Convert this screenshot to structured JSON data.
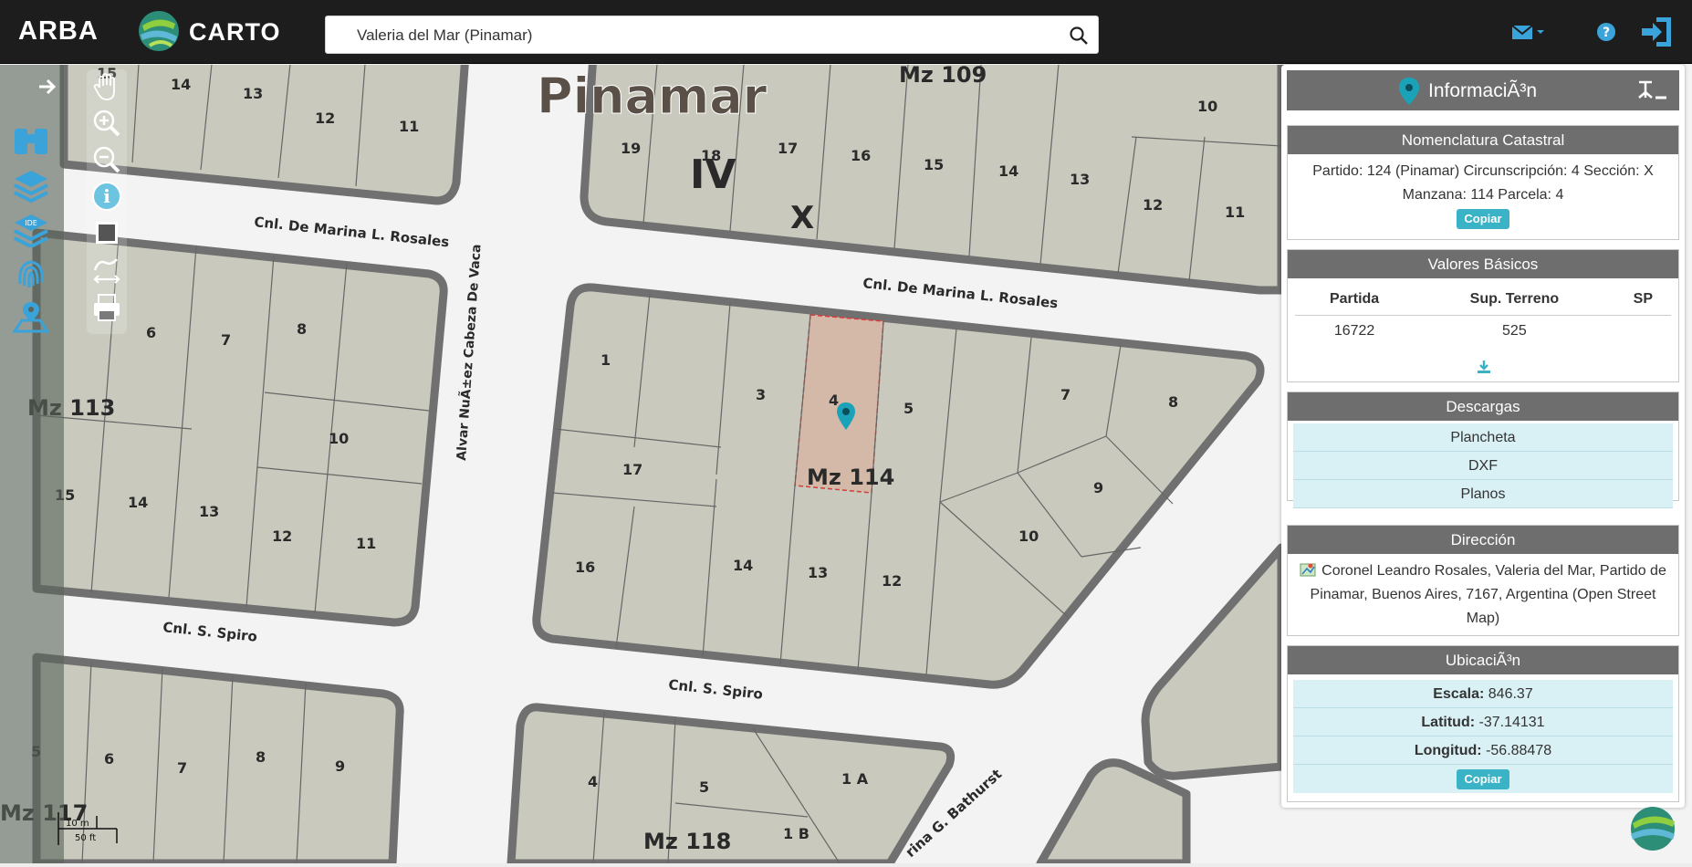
{
  "header": {
    "brand": "ARBA",
    "carto_label": "CARTO",
    "search": {
      "value": "Valeria del Mar (Pinamar)"
    },
    "icons": [
      "mail-icon",
      "chevron-down-icon",
      "help-icon",
      "logout-icon"
    ]
  },
  "map": {
    "city_label": "Pinamar",
    "circ_label": "IV",
    "sec_label": "X",
    "blocks": [
      "Mz 109",
      "Mz 113",
      "Mz 114",
      "Mz 117",
      "Mz 118"
    ],
    "streets": [
      "Cnl. De Marina L. Rosales",
      "Cnl. De Marina L. Rosales",
      "Alvar NuÃ±ez Cabeza De Vaca",
      "Cnl. S. Spiro",
      "Cnl. S. Spiro",
      "rina G. Bathurst"
    ],
    "parcels_114": [
      "1",
      "3",
      "4",
      "5",
      "7",
      "8",
      "9",
      "10",
      "12",
      "13",
      "14",
      "16",
      "17"
    ],
    "parcels_109": [
      "19",
      "18",
      "17",
      "16",
      "15",
      "14",
      "13",
      "12",
      "11",
      "10"
    ],
    "parcels_113": [
      "6",
      "7",
      "8",
      "10",
      "15",
      "14",
      "13",
      "12",
      "11"
    ],
    "parcels_top_left": [
      "15",
      "14",
      "13",
      "12",
      "11"
    ],
    "parcels_118": [
      "4",
      "5",
      "1 A",
      "1 B"
    ],
    "parcels_117": [
      "6",
      "7",
      "8",
      "9",
      "5"
    ],
    "scale": {
      "m": "10 m",
      "ft": "50 ft"
    }
  },
  "toolbar": {
    "left": [
      "arrow-right-icon",
      "binoculars-icon",
      "layers-icon",
      "ide-layers-icon",
      "fingerprint-icon",
      "map-location-icon"
    ],
    "zoom": [
      "hand-icon",
      "zoom-in-icon",
      "zoom-out-icon",
      "info-icon",
      "extent-icon",
      "measure-icon",
      "print-icon"
    ]
  },
  "panel": {
    "title": "InformaciÃ³n",
    "nomenclatura": {
      "heading": "Nomenclatura Catastral",
      "text": "Partido: 124 (Pinamar) Circunscripción: 4 Sección: X Manzana: 114 Parcela: 4",
      "copy": "Copiar"
    },
    "valores": {
      "heading": "Valores Básicos",
      "columns": [
        "Partida",
        "Sup. Terreno",
        "SP"
      ],
      "row": [
        "16722",
        "525",
        ""
      ]
    },
    "descargas": {
      "heading": "Descargas",
      "items": [
        "Plancheta",
        "DXF",
        "Planos"
      ]
    },
    "direccion": {
      "heading": "Dirección",
      "text": "Coronel Leandro Rosales, Valeria del Mar, Partido de Pinamar, Buenos Aires, 7167, Argentina (Open Street Map)"
    },
    "ubicacion": {
      "heading": "UbicaciÃ³n",
      "escala_label": "Escala:",
      "escala": "846.37",
      "lat_label": "Latitud:",
      "lat": "-37.14131",
      "lon_label": "Longitud:",
      "lon": "-56.88478",
      "copy": "Copiar"
    }
  },
  "colors": {
    "accent": "#3bb3c6",
    "header": "#6e6e6e",
    "parcel": "#c9cabd",
    "selected": "#d4b9a8",
    "pin": "#1aa3b8"
  }
}
